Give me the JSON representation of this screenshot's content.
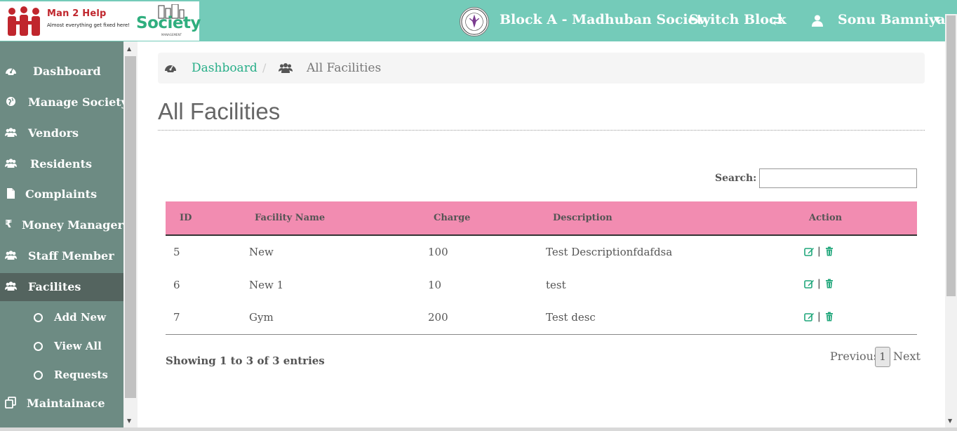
{
  "header": {
    "brand_name": "Man 2 Help",
    "brand_tagline": "Almost everything get fixed here!",
    "product_name": "Society",
    "product_subtitle": "MANAGEMENT",
    "block_name": "Block A - Madhuban Society",
    "switch_block_label": "Switch Block",
    "user_name": "Sonu Bamniya",
    "colors": {
      "bar": "#74cbb9",
      "brand_red": "#c0262d",
      "society_green": "#2fae7e"
    }
  },
  "sidebar": {
    "items": [
      {
        "label": "Dashboard",
        "icon": "dashboard-icon"
      },
      {
        "label": "Manage Society",
        "icon": "globe-icon"
      },
      {
        "label": "Vendors",
        "icon": "users-icon"
      },
      {
        "label": "Residents",
        "icon": "users-icon"
      },
      {
        "label": "Complaints",
        "icon": "file-icon"
      },
      {
        "label": "Money Manager",
        "icon": "rupee-icon"
      },
      {
        "label": "Staff Member",
        "icon": "users-icon"
      },
      {
        "label": "Facilites",
        "icon": "users-icon",
        "active": true
      }
    ],
    "sub_items": [
      {
        "label": "Add New"
      },
      {
        "label": "View All"
      },
      {
        "label": "Requests"
      }
    ],
    "bottom_item": {
      "label": "Maintainace",
      "icon": "copy-icon"
    },
    "colors": {
      "background": "#6d8b83",
      "active": "#54645f"
    }
  },
  "breadcrumb": {
    "home": "Dashboard",
    "separator": "/",
    "current": "All Facilities"
  },
  "page": {
    "title": "All Facilities"
  },
  "search": {
    "label": "Search:",
    "value": ""
  },
  "table": {
    "columns": [
      "ID",
      "Facility Name",
      "Charge",
      "Description",
      "Action"
    ],
    "rows": [
      {
        "id": "5",
        "name": "New",
        "charge": "100",
        "description": "Test Descriptionfdafdsa"
      },
      {
        "id": "6",
        "name": "New 1",
        "charge": "10",
        "description": "test"
      },
      {
        "id": "7",
        "name": "Gym",
        "charge": "200",
        "description": "Test desc"
      }
    ],
    "action_separator": "|",
    "header_color": "#f28cb1"
  },
  "pagination": {
    "info": "Showing 1 to 3 of 3 entries",
    "previous": "Previous",
    "current_page": "1",
    "next": "Next"
  }
}
